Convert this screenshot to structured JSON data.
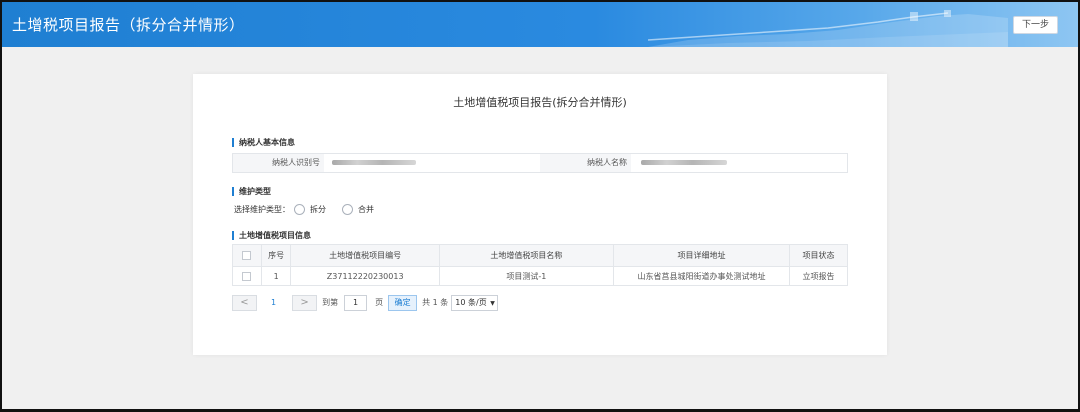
{
  "header": {
    "title": "土增税项目报告（拆分合并情形）",
    "next_label": "下一步"
  },
  "card": {
    "title": "土地增值税项目报告(拆分合并情形)"
  },
  "taxpayer": {
    "section_label": "纳税人基本信息",
    "id_label": "纳税人识别号",
    "name_label": "纳税人名称"
  },
  "maintenance": {
    "section_label": "维护类型",
    "select_label": "选择维护类型：",
    "option_split": "拆分",
    "option_merge": "合并"
  },
  "projects": {
    "section_label": "土地增值税项目信息",
    "columns": [
      "序号",
      "土地增值税项目编号",
      "土地增值税项目名称",
      "项目详细地址",
      "项目状态"
    ],
    "rows": [
      {
        "index": "1",
        "code": "Z37112220230013",
        "name": "项目测试-1",
        "address": "山东省莒县城阳街道办事处测试地址",
        "status": "立项报告"
      }
    ]
  },
  "pagination": {
    "prev": "<",
    "current_page": "1",
    "next": ">",
    "goto_prefix": "到第",
    "goto_value": "1",
    "goto_suffix": "页",
    "confirm_label": "确定",
    "total_text": "共 1 条",
    "page_size": "10 条/页"
  },
  "colors": {
    "accent": "#1f7fd2",
    "header_bg": "#2a8ae0",
    "page_bg": "#f0f0f0"
  }
}
